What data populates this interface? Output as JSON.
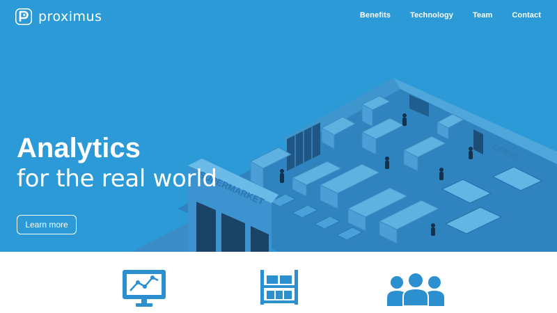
{
  "brand": {
    "name": "proximus",
    "logo_icon": "proximus-p-logo-icon"
  },
  "nav": {
    "links": [
      {
        "label": "Benefits"
      },
      {
        "label": "Technology"
      },
      {
        "label": "Team"
      },
      {
        "label": "Contact"
      }
    ]
  },
  "hero": {
    "title": "Analytics",
    "subtitle": "for the real world",
    "cta_label": "Learn more",
    "illustration": "isometric-supermarket-illustration",
    "store_sign": "SUPERMARKET",
    "background_color": "#2b9ad6"
  },
  "features": {
    "icons": [
      {
        "name": "analytics-monitor-icon"
      },
      {
        "name": "shelf-inventory-icon"
      },
      {
        "name": "team-people-icon"
      }
    ],
    "icon_color": "#2b8fd0"
  }
}
